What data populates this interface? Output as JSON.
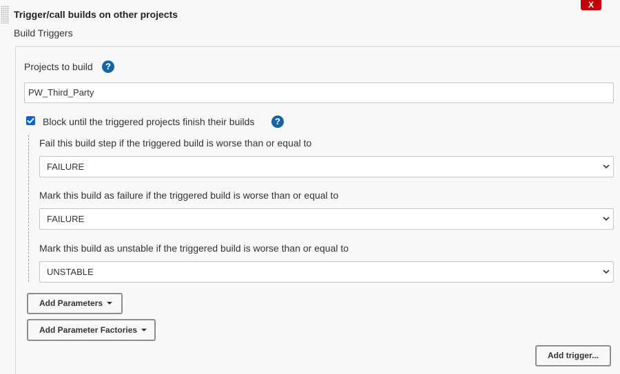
{
  "section": {
    "title": "Trigger/call builds on other projects",
    "delete_label": "X",
    "subtitle": "Build Triggers"
  },
  "projects": {
    "label": "Projects to build",
    "value": "PW_Third_Party"
  },
  "block": {
    "label": "Block until the triggered projects finish their builds",
    "checked": true
  },
  "thresholds": [
    {
      "label": "Fail this build step if the triggered build is worse than or equal to",
      "value": "FAILURE"
    },
    {
      "label": "Mark this build as failure if the triggered build is worse than or equal to",
      "value": "FAILURE"
    },
    {
      "label": "Mark this build as unstable if the triggered build is worse than or equal to",
      "value": "UNSTABLE"
    }
  ],
  "buttons": {
    "add_parameters": "Add Parameters",
    "add_parameter_factories": "Add Parameter Factories",
    "add_trigger": "Add trigger..."
  },
  "help_icon_glyph": "?",
  "icons": {
    "help": "question-circle-icon",
    "checkbox": "checkmark-icon",
    "select": "chevron-down-icon",
    "dropdown": "caret-down-icon",
    "drag": "drag-handle-icon"
  },
  "colors": {
    "delete": "#c4000a",
    "help": "#1565a5",
    "checkbox": "#0a63ce",
    "background": "#f8f8f8"
  }
}
